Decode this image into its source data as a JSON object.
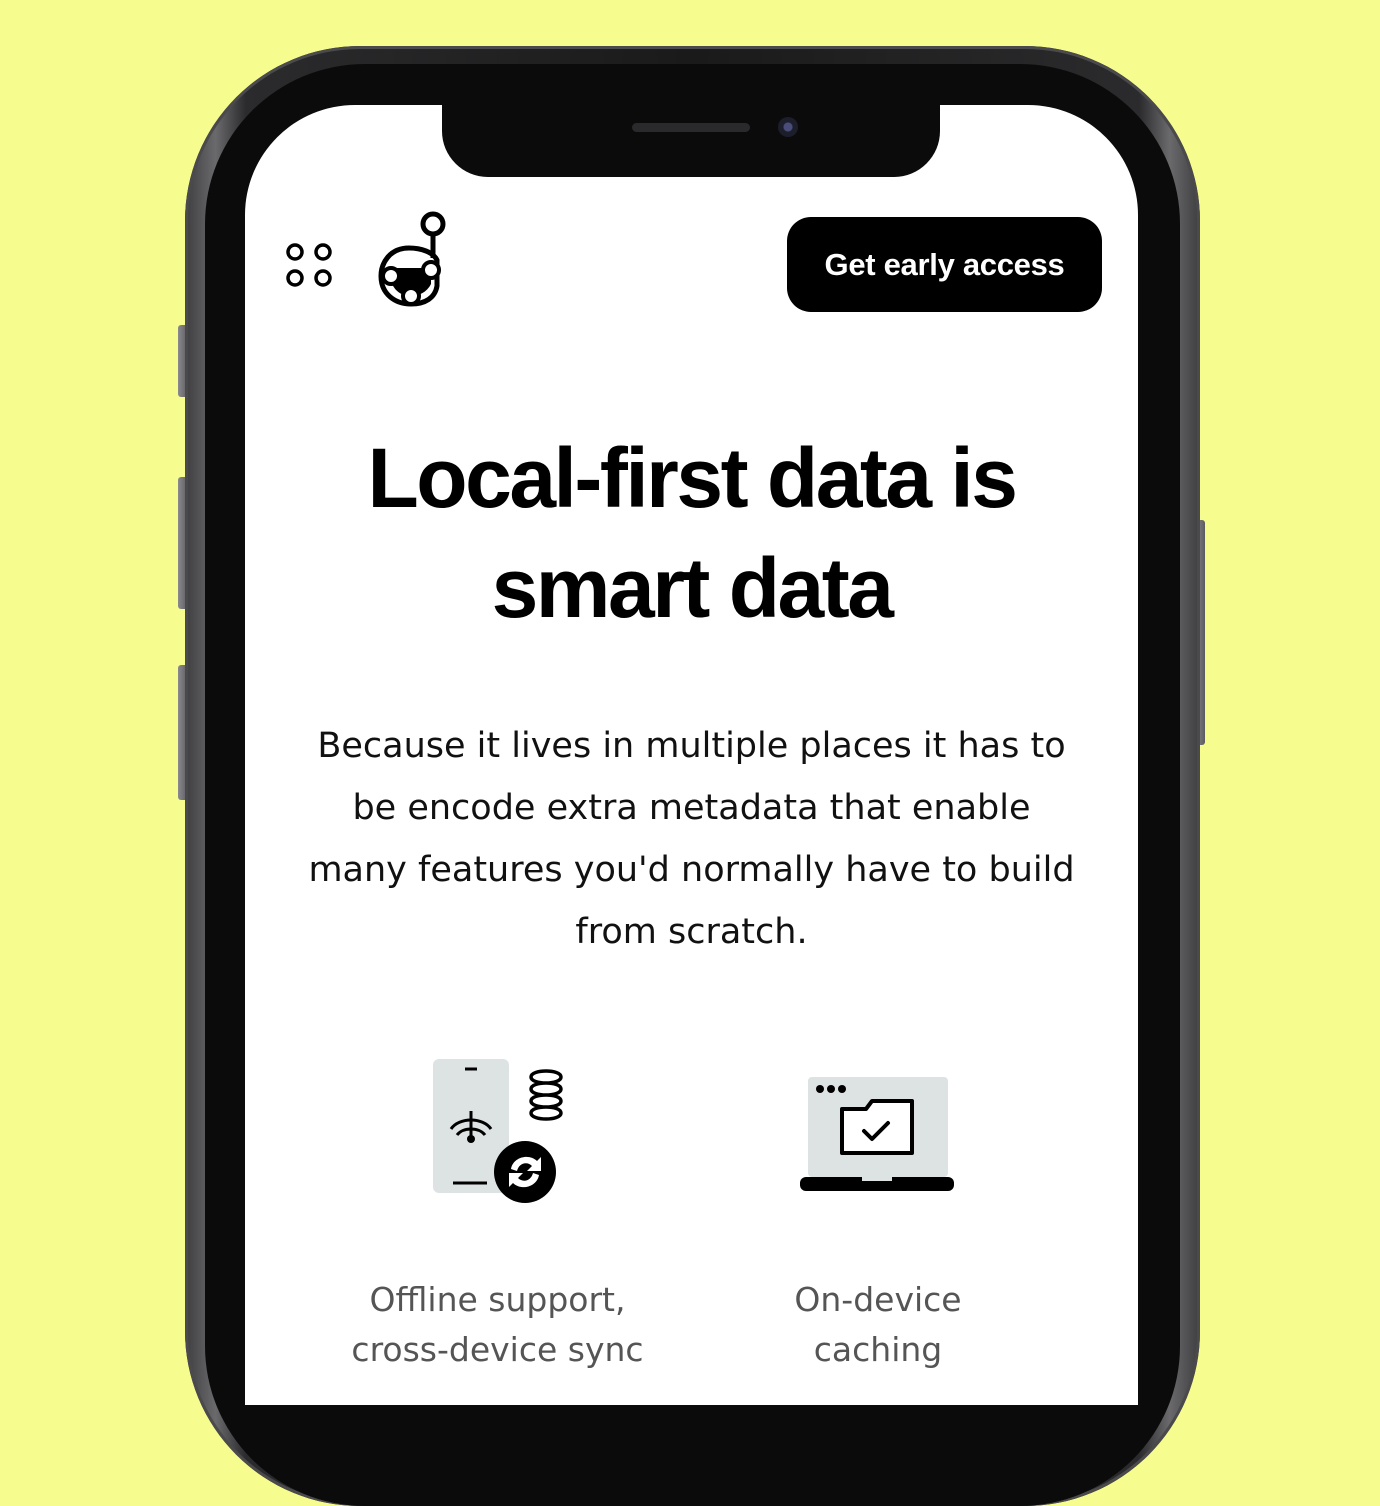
{
  "header": {
    "menu_icon": "app-grid-icon",
    "logo_icon": "graph-node-logo-icon",
    "cta_label": "Get early access"
  },
  "hero": {
    "title_line1": "Local-first data is",
    "title_line2": "smart data",
    "description": "Because it lives in multiple places it has to be encode extra metadata that enable many features you'd normally have to build from scratch."
  },
  "features": [
    {
      "icon": "phone-sync-offline-icon",
      "label_line1": "Offline support,",
      "label_line2": "cross-device sync"
    },
    {
      "icon": "laptop-folder-check-icon",
      "label_line1": "On-device",
      "label_line2": "caching"
    }
  ],
  "colors": {
    "background": "#f6fc8d",
    "screen": "#ffffff",
    "button": "#000000",
    "icon_fill": "#dde3e3"
  }
}
